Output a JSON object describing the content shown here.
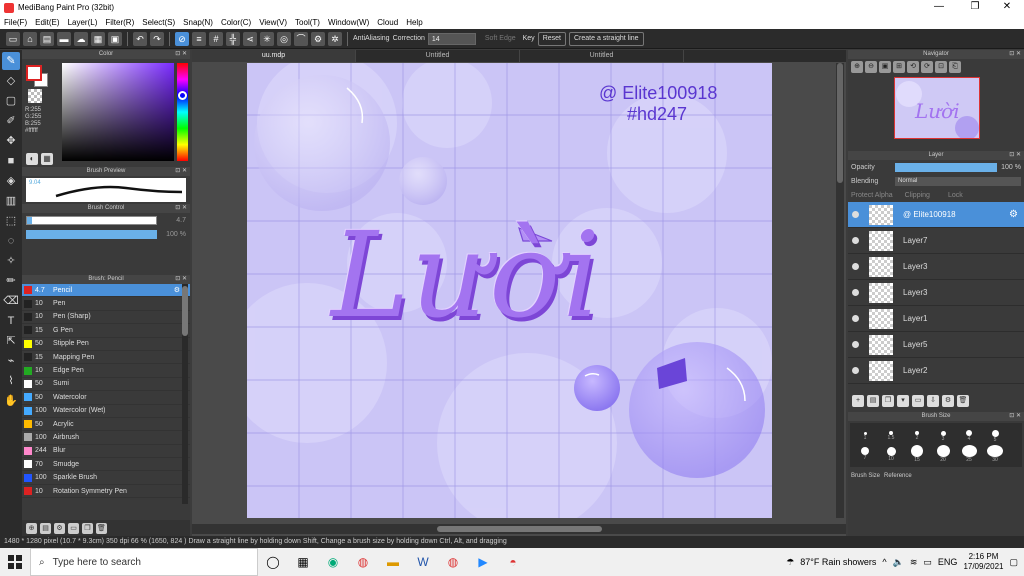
{
  "window": {
    "title": "MediBang Paint Pro (32bit)",
    "minimize": "—",
    "maximize": "❐",
    "close": "✕"
  },
  "menu": [
    "File(F)",
    "Edit(E)",
    "Layer(L)",
    "Filter(R)",
    "Select(S)",
    "Snap(N)",
    "Color(C)",
    "View(V)",
    "Tool(T)",
    "Window(W)",
    "Cloud",
    "Help"
  ],
  "toolbar": {
    "antialias": "AntiAliasing",
    "correction_label": "Correction",
    "correction_value": "14",
    "soft_edge": "Soft Edge",
    "key": "Key",
    "reset": "Reset",
    "straight_line": "Create a straight line"
  },
  "color_panel": {
    "title": "Color",
    "rgb_r": "R:255",
    "rgb_g": "G:255",
    "rgb_b": "B:255",
    "hex": "#ffffff",
    "hue_fraction": 0.32
  },
  "brush_preview": {
    "title": "Brush Preview",
    "size": "9.04"
  },
  "brush_control": {
    "title": "Brush Control",
    "size_value": "4.7",
    "size_fraction": 0.04,
    "opacity_value": "100 %",
    "opacity_fraction": 1.0
  },
  "brush_list": {
    "title": "Brush: Pencil",
    "items": [
      {
        "size": "4.7",
        "name": "Pencil",
        "color": "#d22"
      },
      {
        "size": "10",
        "name": "Pen",
        "color": "#222"
      },
      {
        "size": "10",
        "name": "Pen (Sharp)",
        "color": "#222"
      },
      {
        "size": "15",
        "name": "G Pen",
        "color": "#222"
      },
      {
        "size": "50",
        "name": "Stipple Pen",
        "color": "#ff0"
      },
      {
        "size": "15",
        "name": "Mapping Pen",
        "color": "#222"
      },
      {
        "size": "10",
        "name": "Edge Pen",
        "color": "#2a2"
      },
      {
        "size": "50",
        "name": "Sumi",
        "color": "#fff"
      },
      {
        "size": "50",
        "name": "Watercolor",
        "color": "#4af"
      },
      {
        "size": "100",
        "name": "Watercolor (Wet)",
        "color": "#4af"
      },
      {
        "size": "50",
        "name": "Acrylic",
        "color": "#fb0"
      },
      {
        "size": "100",
        "name": "Airbrush",
        "color": "#aaa"
      },
      {
        "size": "244",
        "name": "Blur",
        "color": "#f8c"
      },
      {
        "size": "70",
        "name": "Smudge",
        "color": "#fff"
      },
      {
        "size": "100",
        "name": "Sparkle Brush",
        "color": "#25f"
      },
      {
        "size": "10",
        "name": "Rotation Symmetry Pen",
        "color": "#d22"
      }
    ]
  },
  "tabs": [
    "uu.mdp",
    "Untitled",
    "Untitled"
  ],
  "canvas_text": {
    "watermark_line1": "@ Elite100918",
    "watermark_line2": "#hd247",
    "title": "Lười"
  },
  "navigator": {
    "title": "Navigator",
    "icons": [
      "⊕",
      "⊖",
      "▣",
      "⊞",
      "⟲",
      "⟳",
      "⊡",
      "⎗"
    ]
  },
  "layer_panel": {
    "title": "Layer",
    "opacity_label": "Opacity",
    "opacity_value": "100 %",
    "opacity_fraction": 1.0,
    "blending_label": "Blending",
    "blending_value": "Normal",
    "protect_alpha": "Protect Alpha",
    "clipping": "Clipping",
    "lock": "Lock",
    "layers": [
      "@ Elite100918",
      "Layer7",
      "Layer3",
      "Layer3",
      "Layer1",
      "Layer5",
      "Layer2"
    ]
  },
  "brush_size": {
    "title": "Brush Size",
    "sizes": [
      "1",
      "1.5",
      "2",
      "3",
      "4",
      "5",
      "7",
      "10",
      "15",
      "20",
      "25",
      "30"
    ],
    "tab1": "Brush Size",
    "tab2": "Reference"
  },
  "status": "1480 * 1280 pixel (10.7 * 9.3cm) 350 dpi 66 % (1650, 824 ) Draw a straight line by holding down Shift, Change a brush size by holding down Ctrl, Alt, and dragging",
  "taskbar": {
    "search_placeholder": "Type here to search",
    "weather": "87°F Rain showers",
    "lang": "ENG",
    "time": "2:16 PM",
    "date": "17/09/2021"
  }
}
